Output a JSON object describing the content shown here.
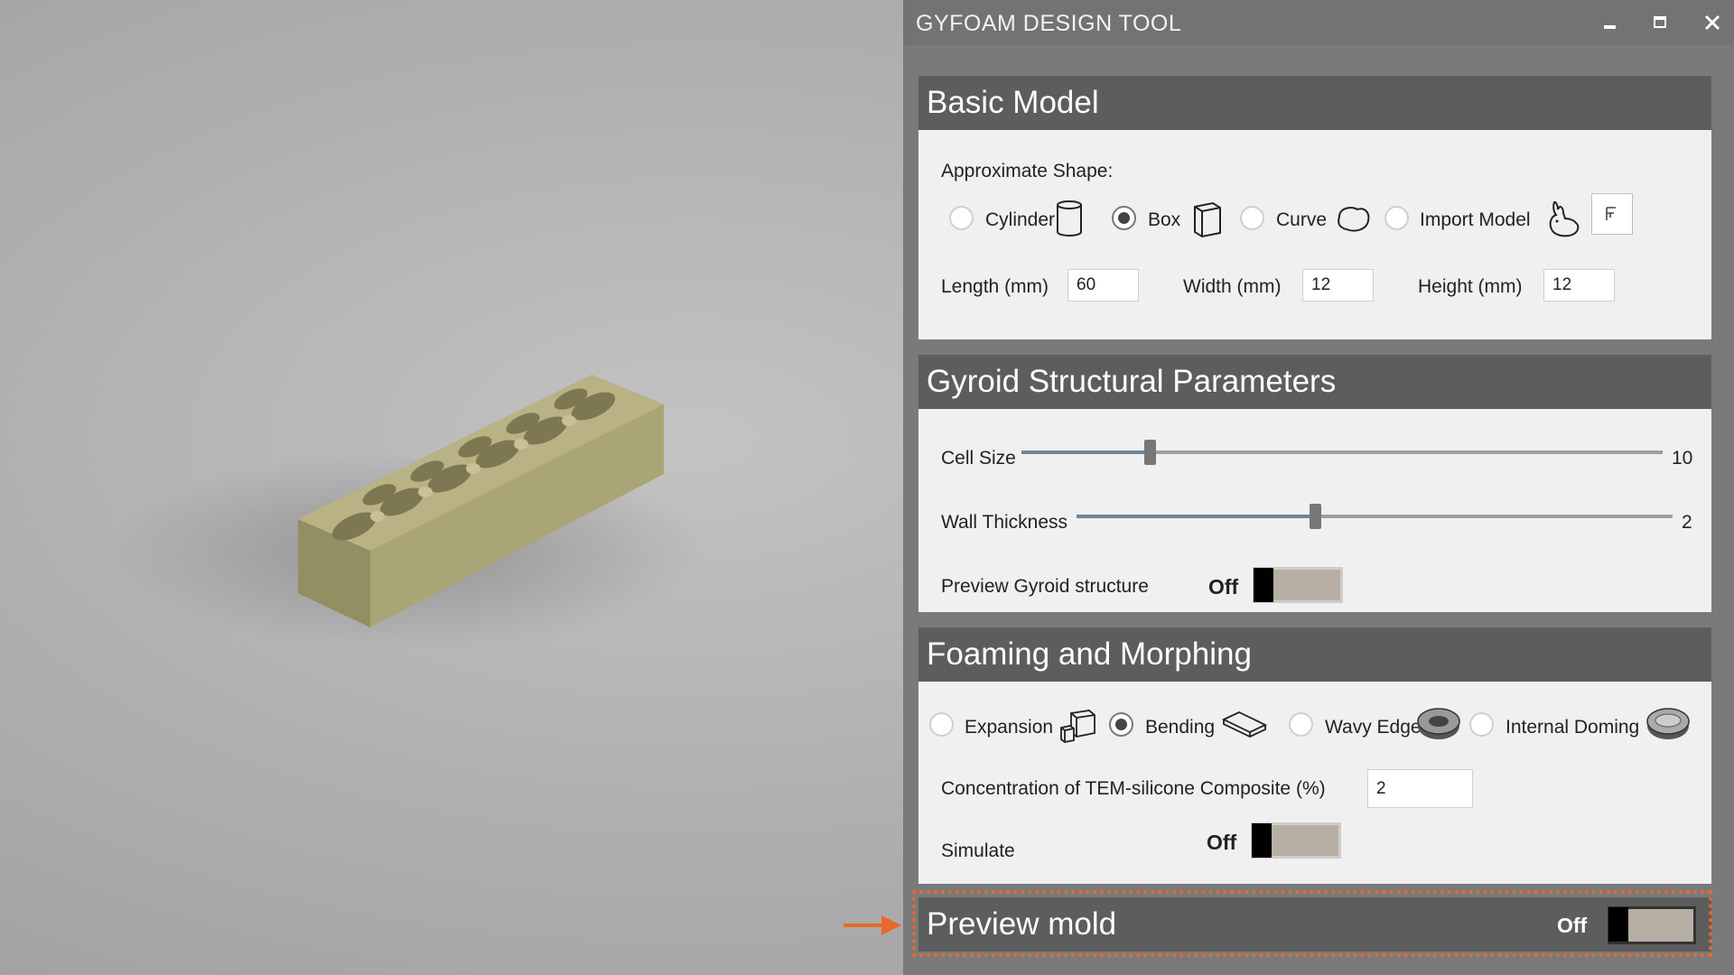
{
  "app": {
    "title": "GYFOAM DESIGN TOOL",
    "window_buttons": [
      "minimize-icon",
      "maximize-icon",
      "close-icon"
    ]
  },
  "basic_model": {
    "title": "Basic Model",
    "shape_label": "Approximate Shape:",
    "shapes": [
      {
        "label": "Cylinder",
        "icon": "cylinder-icon",
        "selected": false
      },
      {
        "label": "Box",
        "icon": "box-icon",
        "selected": true
      },
      {
        "label": "Curve",
        "icon": "curve-icon",
        "selected": false
      },
      {
        "label": "Import Model",
        "icon": "bunny-icon",
        "selected": false
      }
    ],
    "import_button_icon": "file-import-icon",
    "length_label": "Length (mm)",
    "length_value": "60",
    "width_label": "Width (mm)",
    "width_value": "12",
    "height_label": "Height (mm)",
    "height_value": "12"
  },
  "gyroid": {
    "title": "Gyroid Structural Parameters",
    "cell_size_label": "Cell Size",
    "cell_size_value": "10",
    "cell_size_fraction": 0.2,
    "wall_thickness_label": "Wall Thickness",
    "wall_thickness_value": "2",
    "wall_thickness_fraction": 0.4,
    "preview_label": "Preview Gyroid structure",
    "preview_state": "Off"
  },
  "foaming": {
    "title": "Foaming and Morphing",
    "modes": [
      {
        "label": "Expansion",
        "icon": "expansion-icon",
        "selected": false
      },
      {
        "label": "Bending",
        "icon": "bending-icon",
        "selected": true
      },
      {
        "label": "Wavy Edges",
        "icon": "wavy-edges-icon",
        "selected": false
      },
      {
        "label": "Internal Doming",
        "icon": "internal-doming-icon",
        "selected": false
      }
    ],
    "concentration_label": "Concentration of TEM-silicone Composite  (%)",
    "concentration_value": "2",
    "simulate_label": "Simulate",
    "simulate_state": "Off"
  },
  "preview_mold": {
    "title": "Preview mold",
    "state": "Off",
    "highlight_color": "#e8692b"
  }
}
